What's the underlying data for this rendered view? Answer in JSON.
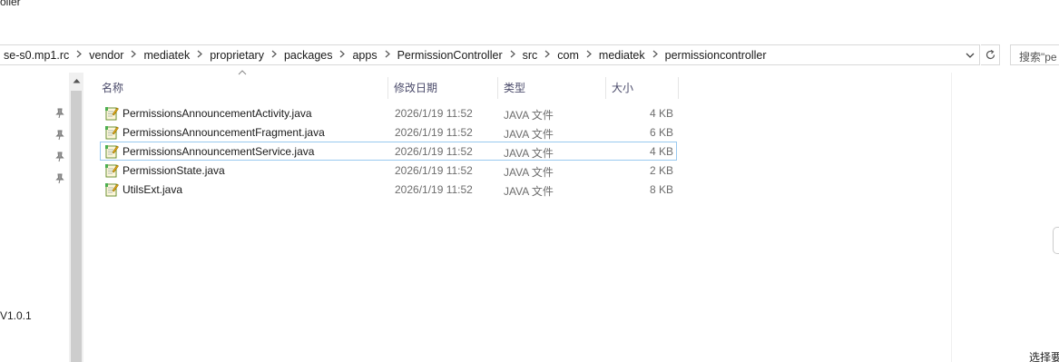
{
  "window": {
    "title_fragment": "oller"
  },
  "address_bar": {
    "crumbs": [
      "se-s0.mp1.rc",
      "vendor",
      "mediatek",
      "proprietary",
      "packages",
      "apps",
      "PermissionController",
      "src",
      "com",
      "mediatek",
      "permissioncontroller"
    ],
    "dropdown_icon": "chevron-down-icon",
    "refresh_icon": "refresh-icon"
  },
  "search": {
    "placeholder": "搜索\"pe"
  },
  "nav_pane": {
    "label": "V1.0.1",
    "pinned_count": 4
  },
  "columns": {
    "name": "名称",
    "date": "修改日期",
    "type": "类型",
    "size": "大小"
  },
  "files": [
    {
      "name": "PermissionsAnnouncementActivity.java",
      "date": "2026/1/19 11:52",
      "type": "JAVA 文件",
      "size": "4 KB"
    },
    {
      "name": "PermissionsAnnouncementFragment.java",
      "date": "2026/1/19 11:52",
      "type": "JAVA 文件",
      "size": "6 KB"
    },
    {
      "name": "PermissionsAnnouncementService.java",
      "date": "2026/1/19 11:52",
      "type": "JAVA 文件",
      "size": "4 KB"
    },
    {
      "name": "PermissionState.java",
      "date": "2026/1/19 11:52",
      "type": "JAVA 文件",
      "size": "2 KB"
    },
    {
      "name": "UtilsExt.java",
      "date": "2026/1/19 11:52",
      "type": "JAVA 文件",
      "size": "8 KB"
    }
  ],
  "focused_row": 2,
  "status": {
    "text": "选择要"
  },
  "colors": {
    "focus_border": "#99c9ef",
    "header_text": "#4a4a6a",
    "muted_text": "#6d6d6d"
  }
}
